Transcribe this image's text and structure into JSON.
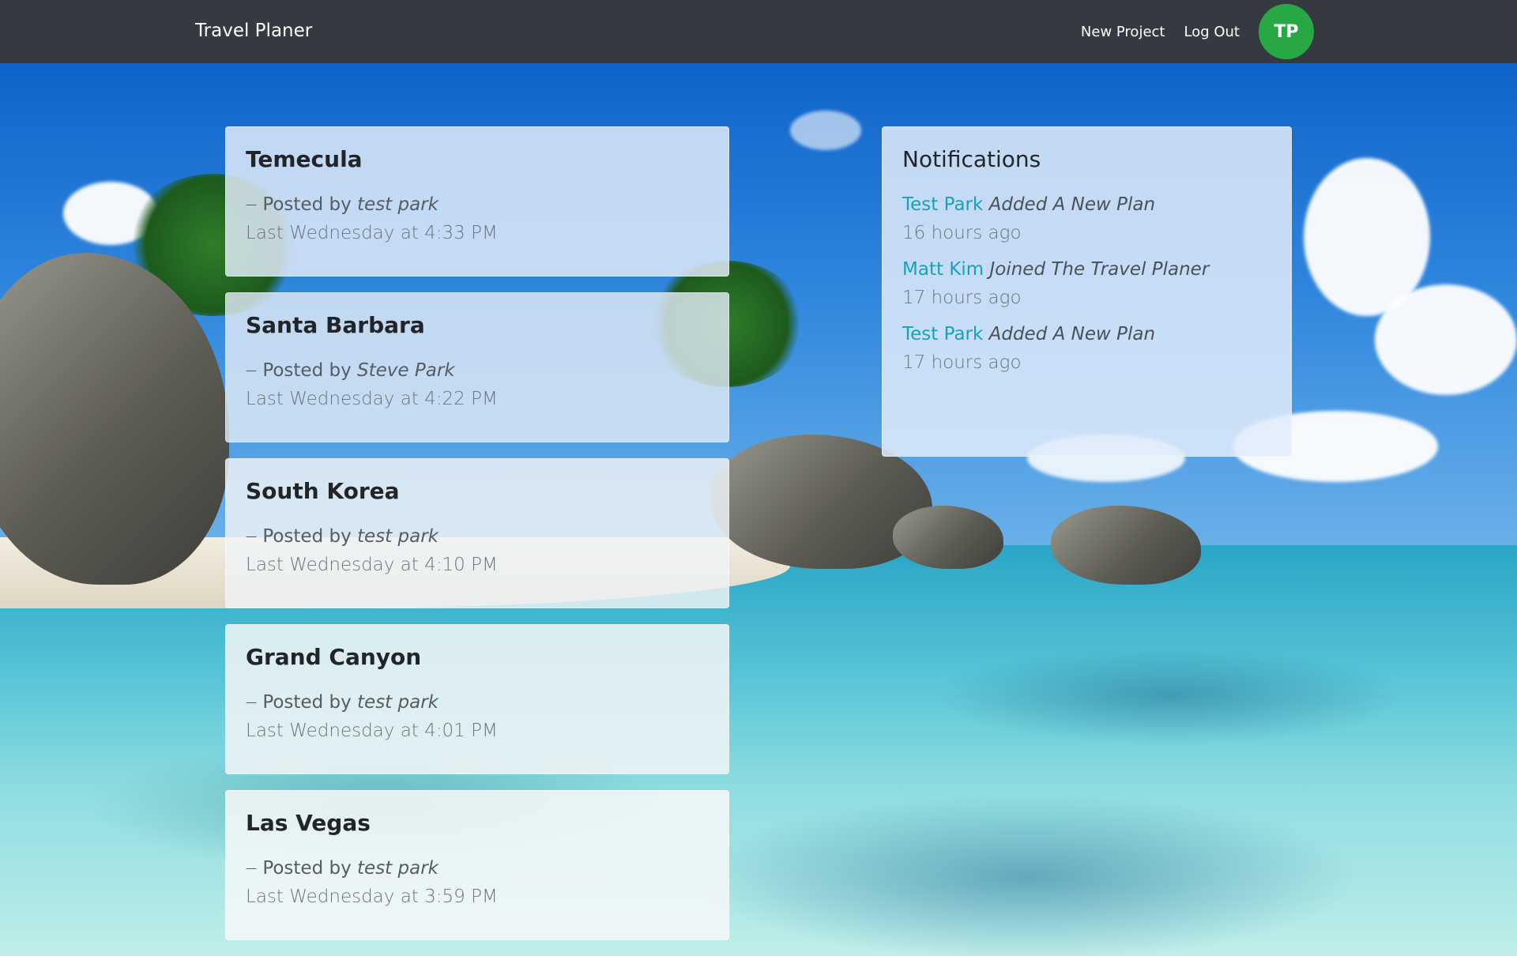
{
  "navbar": {
    "brand": "Travel Planer",
    "links": [
      {
        "label": "New Project"
      },
      {
        "label": "Log Out"
      }
    ],
    "avatar_initials": "TP",
    "avatar_color": "#28a745",
    "background": "#343a40"
  },
  "posts": [
    {
      "title": "Temecula",
      "posted_by_prefix": "Posted by",
      "author": "test park",
      "time": "Last Wednesday at 4:33 PM"
    },
    {
      "title": "Santa Barbara",
      "posted_by_prefix": "Posted by",
      "author": "Steve Park",
      "time": "Last Wednesday at 4:22 PM"
    },
    {
      "title": "South Korea",
      "posted_by_prefix": "Posted by",
      "author": "test park",
      "time": "Last Wednesday at 4:10 PM"
    },
    {
      "title": "Grand Canyon",
      "posted_by_prefix": "Posted by",
      "author": "test park",
      "time": "Last Wednesday at 4:01 PM"
    },
    {
      "title": "Las Vegas",
      "posted_by_prefix": "Posted by",
      "author": "test park",
      "time": "Last Wednesday at 3:59 PM"
    }
  ],
  "notifications": {
    "title": "Notifications",
    "items": [
      {
        "name": "Test Park",
        "action": "Added A New Plan",
        "time": "16 hours ago"
      },
      {
        "name": "Matt Kim",
        "action": "Joined The Travel Planer",
        "time": "17 hours ago"
      },
      {
        "name": "Test Park",
        "action": "Added A New Plan",
        "time": "17 hours ago"
      }
    ]
  },
  "colors": {
    "link": "#17a2b8",
    "muted": "#6c757d"
  }
}
